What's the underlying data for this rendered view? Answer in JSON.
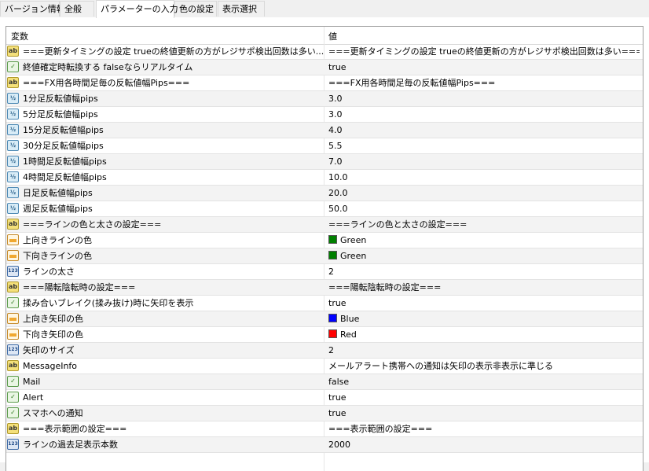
{
  "tabs": [
    {
      "label": "バージョン情報",
      "active": false
    },
    {
      "label": "全般",
      "active": false
    },
    {
      "label": "パラメーターの入力",
      "active": true
    },
    {
      "label": "色の設定",
      "active": false
    },
    {
      "label": "表示選択",
      "active": false
    }
  ],
  "table": {
    "col_variable": "変数",
    "col_value": "値",
    "rows": [
      {
        "icon": "string-icon",
        "name": "===更新タイミングの設定 trueの終値更新の方がレジサポ検出回数は多い...",
        "value": "===更新タイミングの設定 trueの終値更新の方がレジサポ検出回数は多い==="
      },
      {
        "icon": "bool-icon",
        "name": "終値確定時転換する falseならリアルタイム",
        "value": "true"
      },
      {
        "icon": "string-icon",
        "name": "===FX用各時間足毎の反転値幅Pips===",
        "value": "===FX用各時間足毎の反転値幅Pips==="
      },
      {
        "icon": "double-icon",
        "name": "1分足反転値幅pips",
        "value": "3.0"
      },
      {
        "icon": "double-icon",
        "name": "5分足反転値幅pips",
        "value": "3.0"
      },
      {
        "icon": "double-icon",
        "name": "15分足反転値幅pips",
        "value": "4.0"
      },
      {
        "icon": "double-icon",
        "name": "30分足反転値幅pips",
        "value": "5.5"
      },
      {
        "icon": "double-icon",
        "name": "1時間足反転値幅pips",
        "value": "7.0"
      },
      {
        "icon": "double-icon",
        "name": "4時間足反転値幅pips",
        "value": "10.0"
      },
      {
        "icon": "double-icon",
        "name": "日足反転値幅pips",
        "value": "20.0"
      },
      {
        "icon": "double-icon",
        "name": "週足反転値幅pips",
        "value": "50.0"
      },
      {
        "icon": "string-icon",
        "name": "===ラインの色と太さの設定===",
        "value": "===ラインの色と太さの設定==="
      },
      {
        "icon": "color-icon",
        "name": "上向きラインの色",
        "value": "Green",
        "swatch": "#008000"
      },
      {
        "icon": "color-icon",
        "name": "下向きラインの色",
        "value": "Green",
        "swatch": "#008000"
      },
      {
        "icon": "int-icon",
        "name": "ラインの太さ",
        "value": "2"
      },
      {
        "icon": "string-icon",
        "name": "===陽転陰転時の設定===",
        "value": "===陽転陰転時の設定==="
      },
      {
        "icon": "bool-icon",
        "name": "揉み合いブレイク(揉み抜け)時に矢印を表示",
        "value": "true"
      },
      {
        "icon": "color-icon",
        "name": "上向き矢印の色",
        "value": "Blue",
        "swatch": "#0000ff"
      },
      {
        "icon": "color-icon",
        "name": "下向き矢印の色",
        "value": "Red",
        "swatch": "#ff0000"
      },
      {
        "icon": "int-icon",
        "name": "矢印のサイズ",
        "value": "2"
      },
      {
        "icon": "string-icon",
        "name": "MessageInfo",
        "value": "メールアラート携帯への通知は矢印の表示非表示に準じる"
      },
      {
        "icon": "bool-icon",
        "name": "Mail",
        "value": "false"
      },
      {
        "icon": "bool-icon",
        "name": "Alert",
        "value": "true"
      },
      {
        "icon": "bool-icon",
        "name": "スマホへの通知",
        "value": "true"
      },
      {
        "icon": "string-icon",
        "name": "===表示範囲の設定===",
        "value": "===表示範囲の設定==="
      },
      {
        "icon": "int-icon",
        "name": "ラインの過去足表示本数",
        "value": "2000"
      }
    ]
  }
}
